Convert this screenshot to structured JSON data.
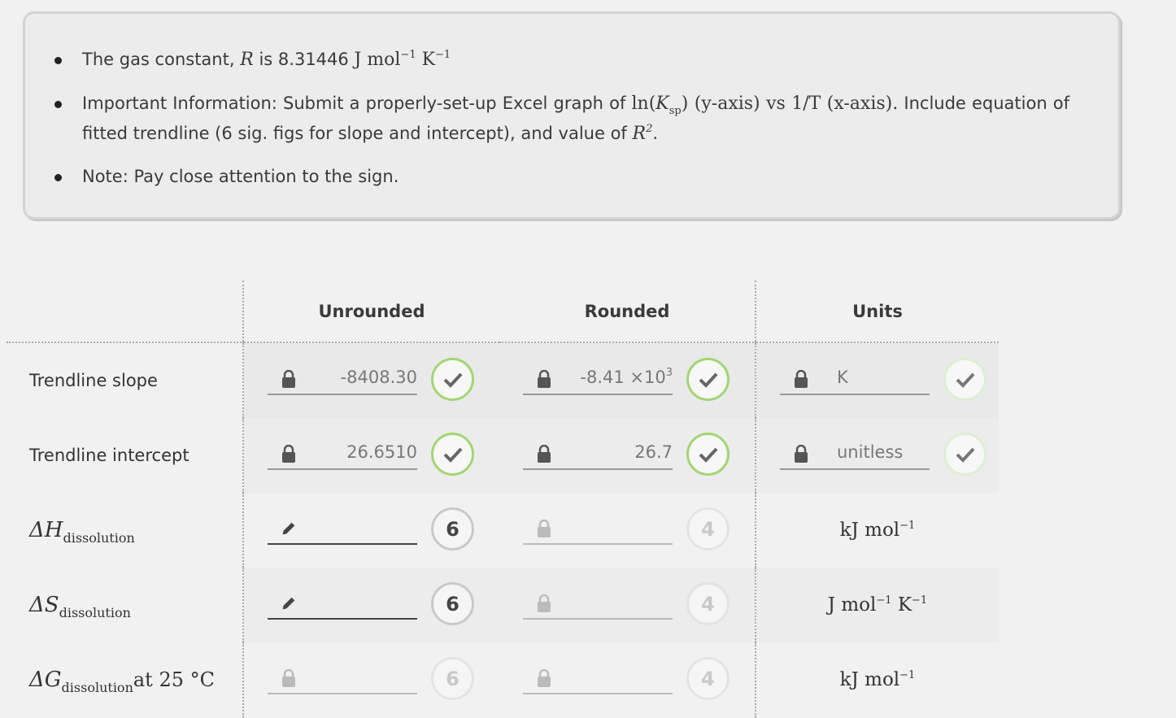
{
  "info": {
    "b1_text": "The gas constant,",
    "b1_var": "R",
    "b1_is": "is 8.31446",
    "b1_unit_j": "J mol",
    "b1_exp": "−1",
    "b1_unit_k": "K",
    "b1_exp2": "−1",
    "b2_line1_a": "Important Information: Submit a properly-set-up Excel graph of",
    "b2_ln": "ln(",
    "b2_k": "K",
    "b2_sp": "sp",
    "b2_rest": ") (y-axis) vs 1/T (x-axis).",
    "b2_include": "Include",
    "b2_line2": "equation of fitted trendline (6 sig. figs for slope and intercept), and value of",
    "b2_r": "R",
    "b2_r_exp": "2",
    "b3_text": "Note: Pay close attention to the sign."
  },
  "table": {
    "col_unrounded": "Unrounded",
    "col_rounded": "Rounded",
    "col_units": "Units",
    "rows": [
      {
        "label": "Trendline slope",
        "unrounded": "-8408.30",
        "rounded": "-8.41 ×10",
        "rounded_exp": "3",
        "units": "K"
      },
      {
        "label": "Trendline intercept",
        "unrounded": "26.6510",
        "rounded": "26.7",
        "units": "unitless"
      },
      {
        "label_sym": "ΔH",
        "label_sub": "dissolution",
        "sig_unrounded": "6",
        "sig_rounded": "4",
        "units_main": "kJ mol",
        "units_exp": "−1"
      },
      {
        "label_sym": "ΔS",
        "label_sub": "dissolution",
        "sig_unrounded": "6",
        "sig_rounded": "4",
        "units_main": "J mol",
        "units_exp": "−1",
        "units_k": "K",
        "units_k_exp": "−1"
      },
      {
        "label_sym": "ΔG",
        "label_sub": "dissolution",
        "label_tail": "at 25 °C",
        "sig_unrounded": "6",
        "sig_rounded": "4",
        "units_main": "kJ mol",
        "units_exp": "−1"
      }
    ]
  },
  "colors": {
    "check_green": "#9fd86d",
    "background": "#f1f1f1"
  }
}
